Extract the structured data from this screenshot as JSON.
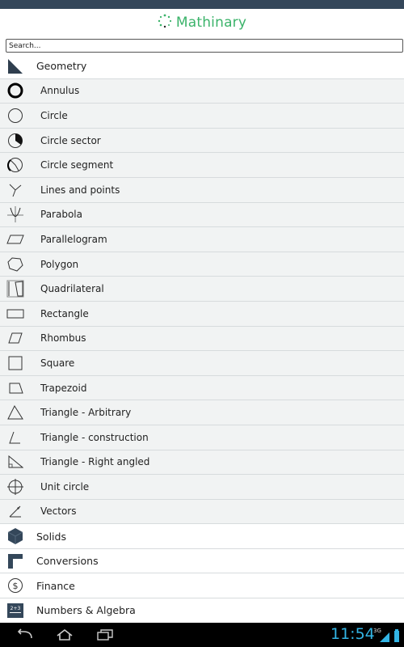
{
  "app": {
    "title": "Mathinary"
  },
  "search": {
    "placeholder": "Search..."
  },
  "categories": [
    {
      "label": "Geometry",
      "icon": "right-triangle-icon"
    },
    {
      "label": "Solids",
      "icon": "cube-icon"
    },
    {
      "label": "Conversions",
      "icon": "corner-icon"
    },
    {
      "label": "Finance",
      "icon": "dollar-icon"
    },
    {
      "label": "Numbers & Algebra",
      "icon": "calculator-icon"
    }
  ],
  "geometry_items": [
    {
      "label": "Annulus",
      "icon": "annulus-icon"
    },
    {
      "label": "Circle",
      "icon": "circle-icon"
    },
    {
      "label": "Circle sector",
      "icon": "circle-sector-icon"
    },
    {
      "label": "Circle segment",
      "icon": "circle-segment-icon"
    },
    {
      "label": "Lines and points",
      "icon": "lines-points-icon"
    },
    {
      "label": "Parabola",
      "icon": "parabola-icon"
    },
    {
      "label": "Parallelogram",
      "icon": "parallelogram-icon"
    },
    {
      "label": "Polygon",
      "icon": "polygon-icon"
    },
    {
      "label": "Quadrilateral",
      "icon": "quadrilateral-icon"
    },
    {
      "label": "Rectangle",
      "icon": "rectangle-icon"
    },
    {
      "label": "Rhombus",
      "icon": "rhombus-icon"
    },
    {
      "label": "Square",
      "icon": "square-icon"
    },
    {
      "label": "Trapezoid",
      "icon": "trapezoid-icon"
    },
    {
      "label": "Triangle - Arbitrary",
      "icon": "triangle-icon"
    },
    {
      "label": "Triangle - construction",
      "icon": "triangle-construction-icon"
    },
    {
      "label": "Triangle - Right angled",
      "icon": "right-angled-triangle-icon"
    },
    {
      "label": "Unit circle",
      "icon": "unit-circle-icon"
    },
    {
      "label": "Vectors",
      "icon": "vectors-icon"
    }
  ],
  "status_bar": {
    "time": "11:54",
    "network": "3G"
  },
  "colors": {
    "accent": "#3bb36a",
    "top_bar": "#34475a",
    "row_bg": "#f1f3f3",
    "clock": "#33b5e5"
  }
}
